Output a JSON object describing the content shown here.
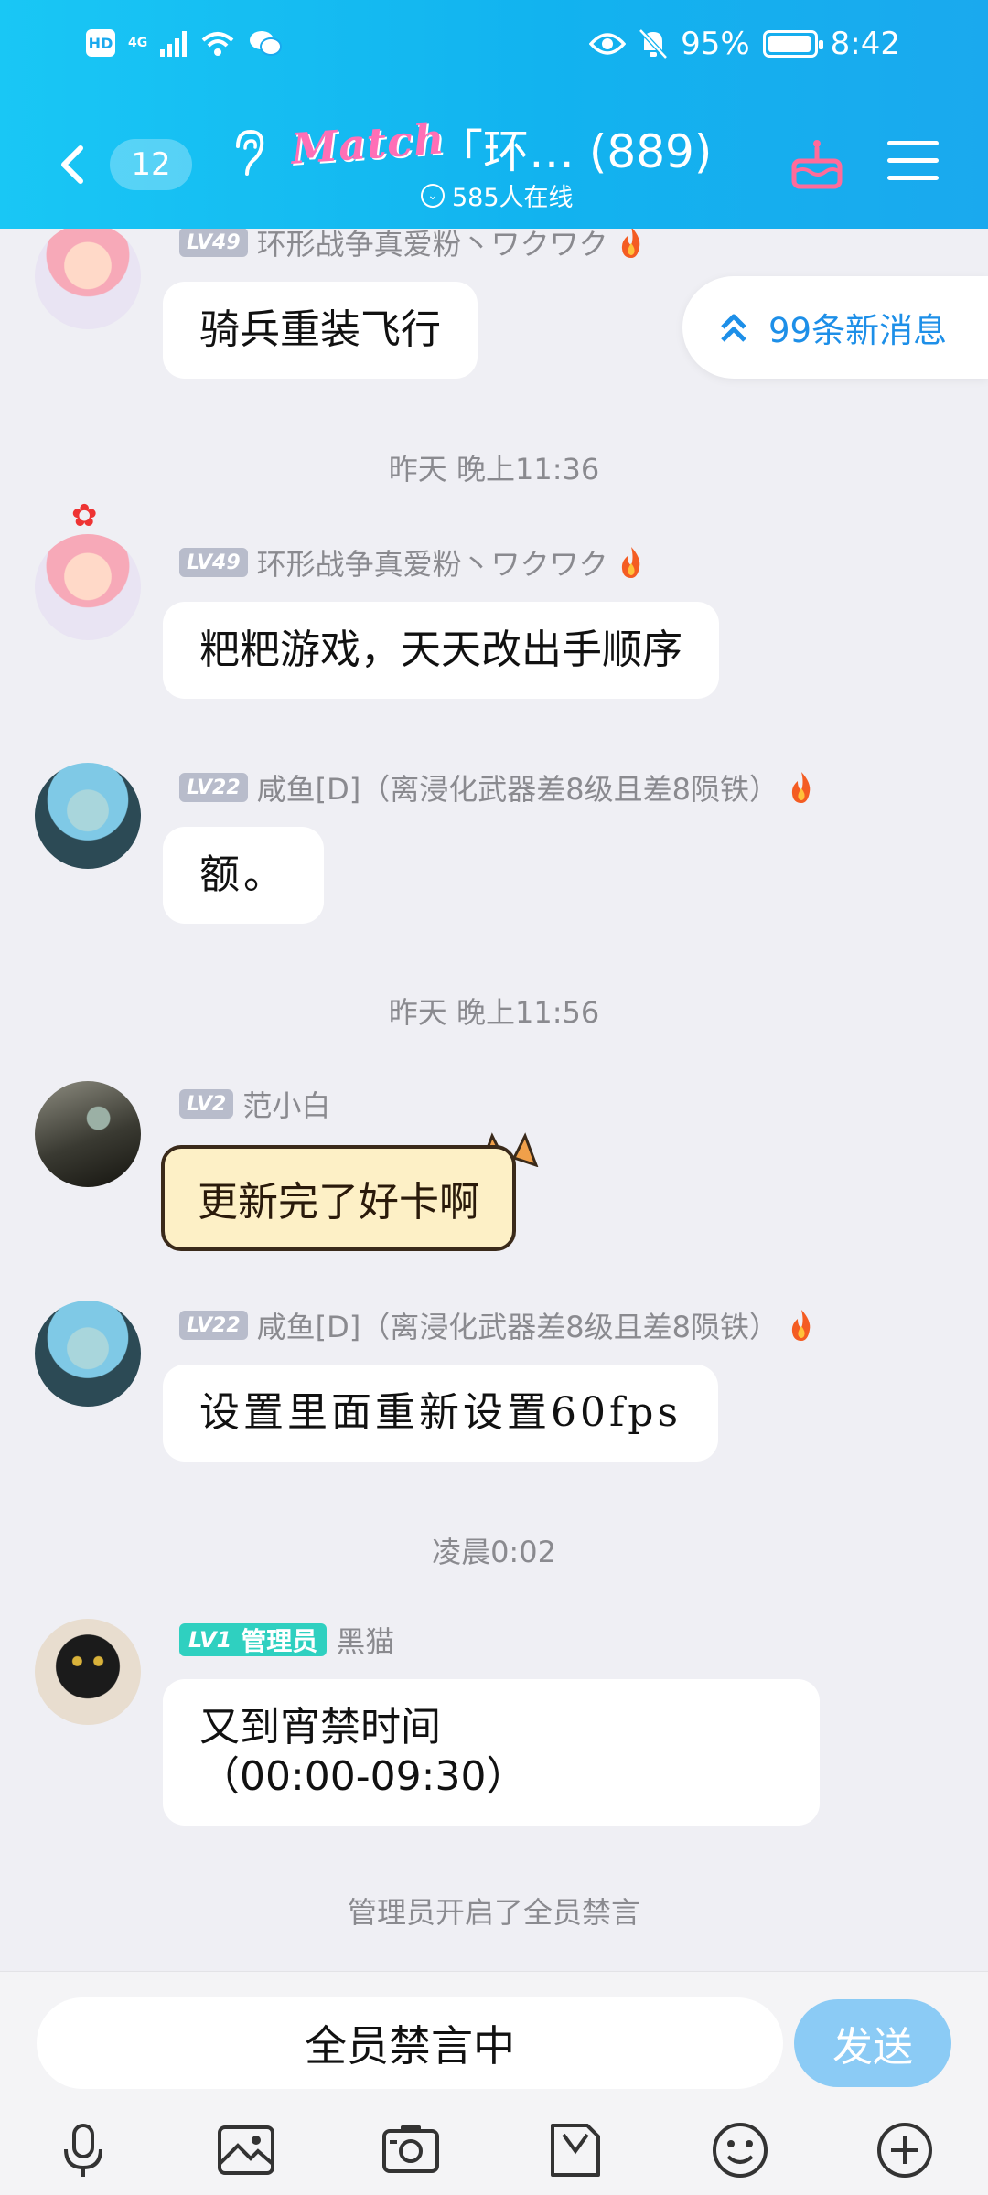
{
  "status_bar": {
    "hd": "HD",
    "network": "4G",
    "battery_percent": "95%",
    "battery_level": 0.95,
    "time": "8:42"
  },
  "header": {
    "unread_count": "12",
    "logo_text": "Match",
    "group_title": "「环…  (889)",
    "online_text": "585人在线",
    "accent_color": "#12b3ef"
  },
  "new_messages": {
    "label": "99条新消息"
  },
  "messages": [
    {
      "type": "message",
      "level": "LV49",
      "sender": "环形战争真爱粉丶ワクワク",
      "text": "骑兵重装飞行"
    },
    {
      "type": "time",
      "text": "昨天 晚上11:36"
    },
    {
      "type": "message",
      "level": "LV49",
      "sender": "环形战争真爱粉丶ワクワク",
      "text": "粑粑游戏，天天改出手顺序"
    },
    {
      "type": "message",
      "level": "LV22",
      "sender": "咸鱼[D]（离浸化武器差8级且差8陨铁）",
      "text": "额。"
    },
    {
      "type": "time",
      "text": "昨天 晚上11:56"
    },
    {
      "type": "message",
      "level": "LV2",
      "sender": "范小白",
      "text": "更新完了好卡啊"
    },
    {
      "type": "message",
      "level": "LV22",
      "sender": "咸鱼[D]（离浸化武器差8级且差8陨铁）",
      "text": "设置里面重新设置60fps"
    },
    {
      "type": "time",
      "text": "凌晨0:02"
    },
    {
      "type": "message",
      "level": "LV1",
      "role": "管理员",
      "sender": "黑猫",
      "text_line1": "又到宵禁时间",
      "text_line2": "（00:00-09:30）"
    },
    {
      "type": "system",
      "text": "管理员开启了全员禁言"
    }
  ],
  "input": {
    "placeholder": "全员禁言中",
    "send_label": "发送"
  },
  "toolbar": [
    "mic-icon",
    "image-icon",
    "camera-icon",
    "file-icon",
    "emoji-icon",
    "plus-icon"
  ]
}
